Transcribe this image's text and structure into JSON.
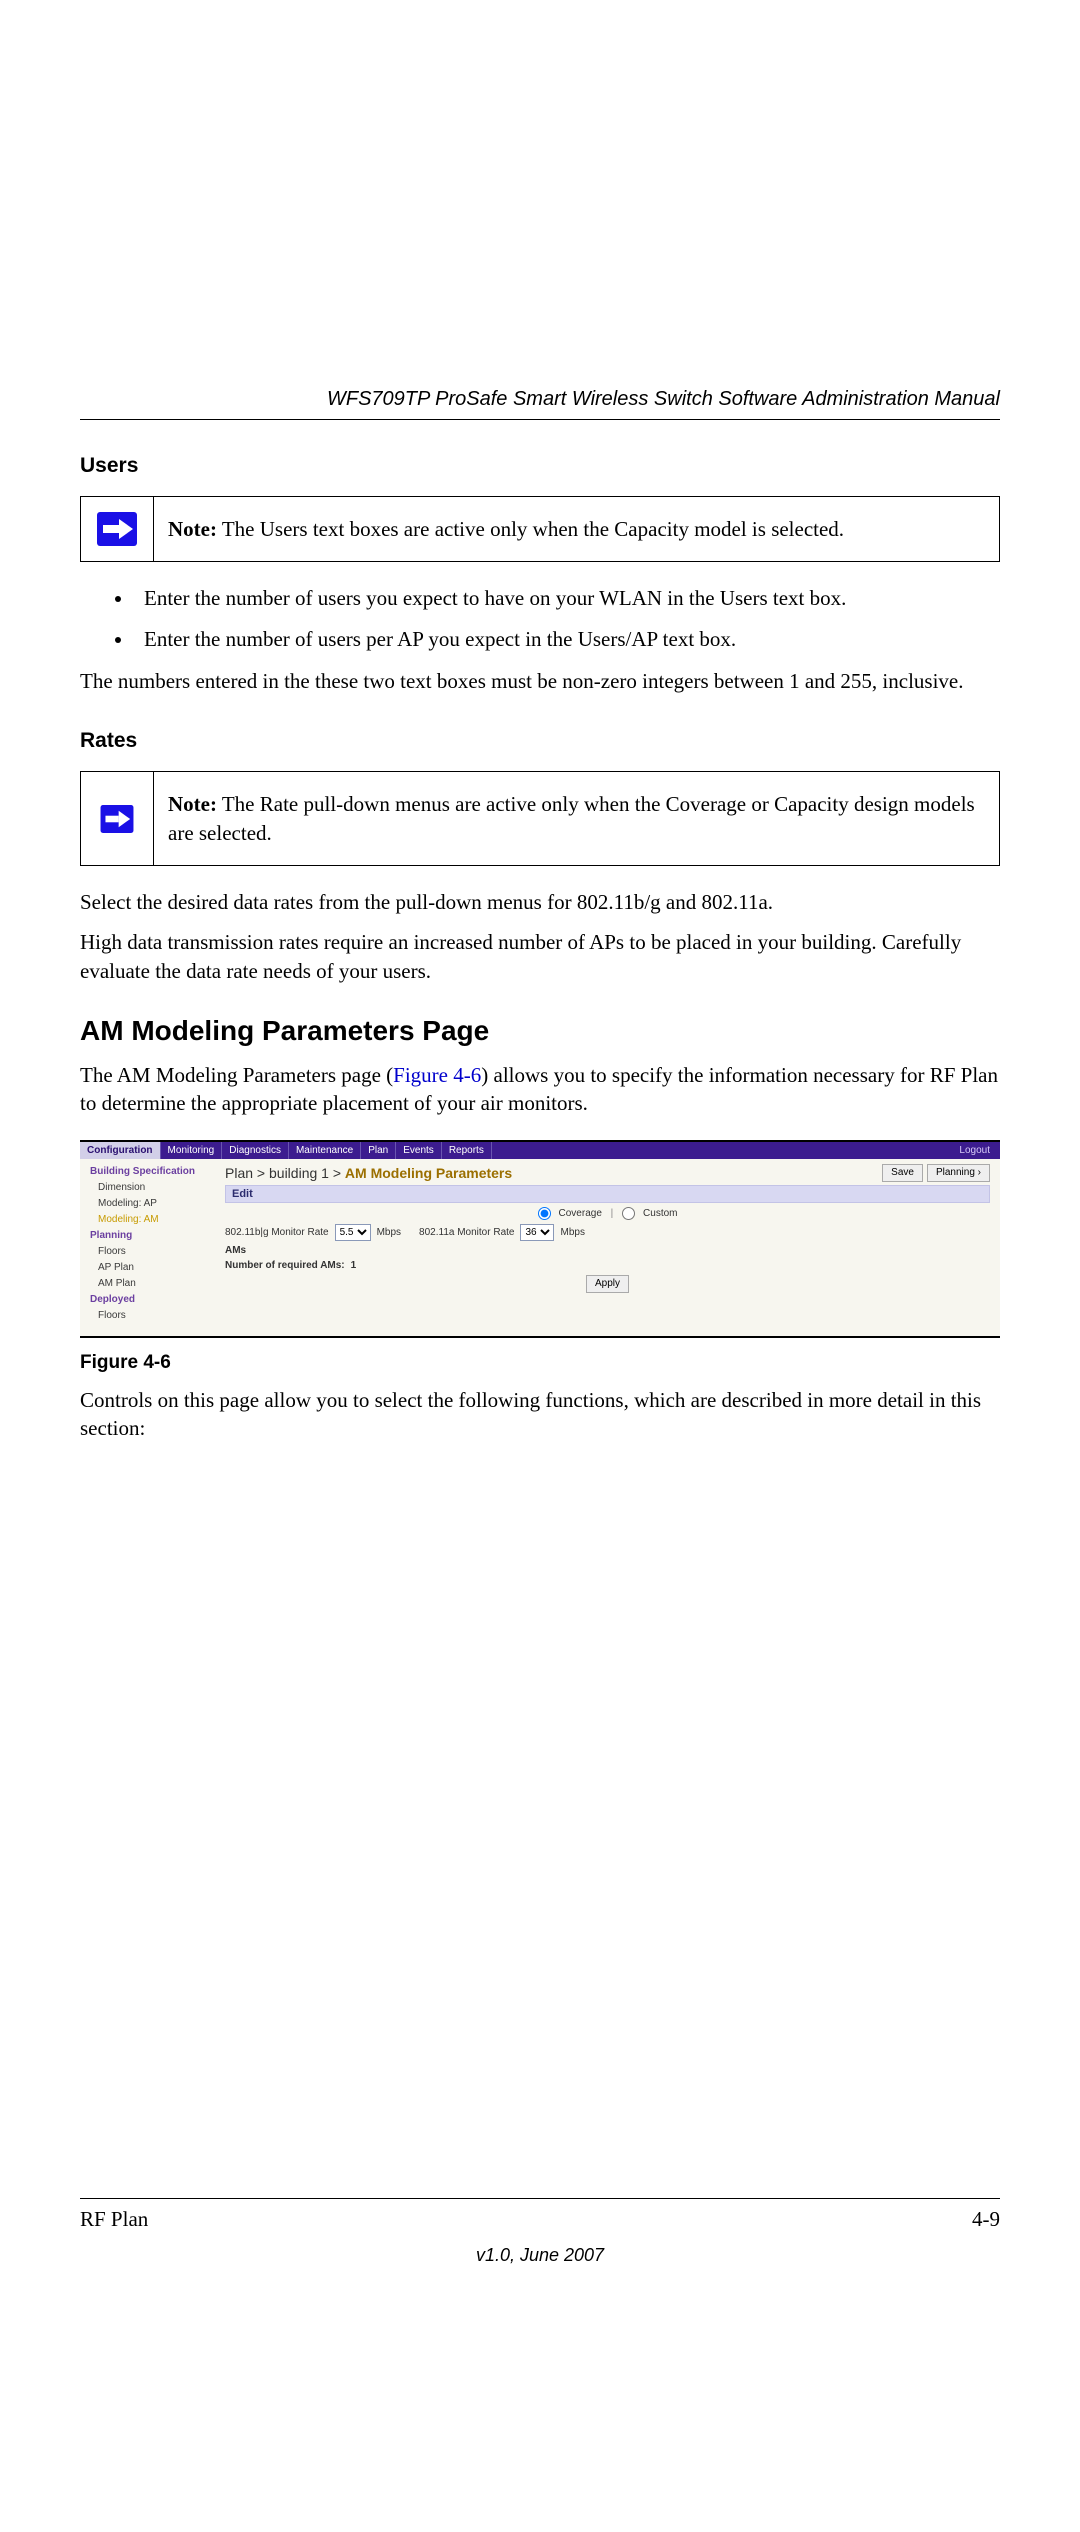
{
  "header": {
    "title": "WFS709TP ProSafe Smart Wireless Switch Software Administration Manual"
  },
  "sections": {
    "users": {
      "label": "Users",
      "note_prefix": "Note:",
      "note_text": " The Users text boxes are active only when the Capacity model is selected.",
      "bullets": [
        "Enter the number of users you expect to have on your WLAN in the Users text box.",
        "Enter the number of users per AP you expect in the Users/AP text box."
      ],
      "para": "The numbers entered in the these two text boxes must be non-zero integers between 1 and 255, inclusive."
    },
    "rates": {
      "label": "Rates",
      "note_prefix": "Note:",
      "note_text": " The Rate pull-down menus are active only when the Coverage or Capacity design models are selected.",
      "para1": "Select the desired data rates from the pull-down menus for 802.11b/g and 802.11a.",
      "para2": "High data transmission rates require an increased number of APs to be placed in your building. Carefully evaluate the data rate needs of your users."
    },
    "am": {
      "heading": "AM Modeling Parameters Page",
      "intro_pre": "The AM Modeling Parameters page (",
      "intro_link": "Figure 4-6",
      "intro_post": ") allows you to specify the information necessary for RF Plan to determine the appropriate placement of your air monitors.",
      "figure_caption": "Figure 4-6",
      "outro": "Controls on this page allow you to select the following functions, which are described in more detail in this section:"
    }
  },
  "ui_capture": {
    "tabs": [
      "Configuration",
      "Monitoring",
      "Diagnostics",
      "Maintenance",
      "Plan",
      "Events",
      "Reports"
    ],
    "logout": "Logout",
    "sidebar": {
      "group1": "Building Specification",
      "items1": [
        "Dimension",
        "Modeling: AP",
        "Modeling: AM"
      ],
      "group2": "Planning",
      "items2": [
        "Floors",
        "AP Plan",
        "AM Plan"
      ],
      "group3": "Deployed",
      "items3": [
        "Floors"
      ]
    },
    "breadcrumb": {
      "a": "Plan",
      "b": "building 1",
      "c": "AM Modeling Parameters"
    },
    "buttons": {
      "save": "Save",
      "planning": "Planning ›"
    },
    "editbar": "Edit",
    "radios": {
      "coverage": "Coverage",
      "custom": "Custom"
    },
    "rate_row": {
      "l1": "802.11b|g Monitor Rate",
      "v1": "5.5",
      "u1": "Mbps",
      "l2": "802.11a Monitor Rate",
      "v2": "36",
      "u2": "Mbps"
    },
    "ams_label": "AMs",
    "req_label": "Number of required AMs: ",
    "req_val": "1",
    "apply": "Apply"
  },
  "footer": {
    "left": "RF Plan",
    "right": "4-9",
    "center": "v1.0, June 2007"
  }
}
